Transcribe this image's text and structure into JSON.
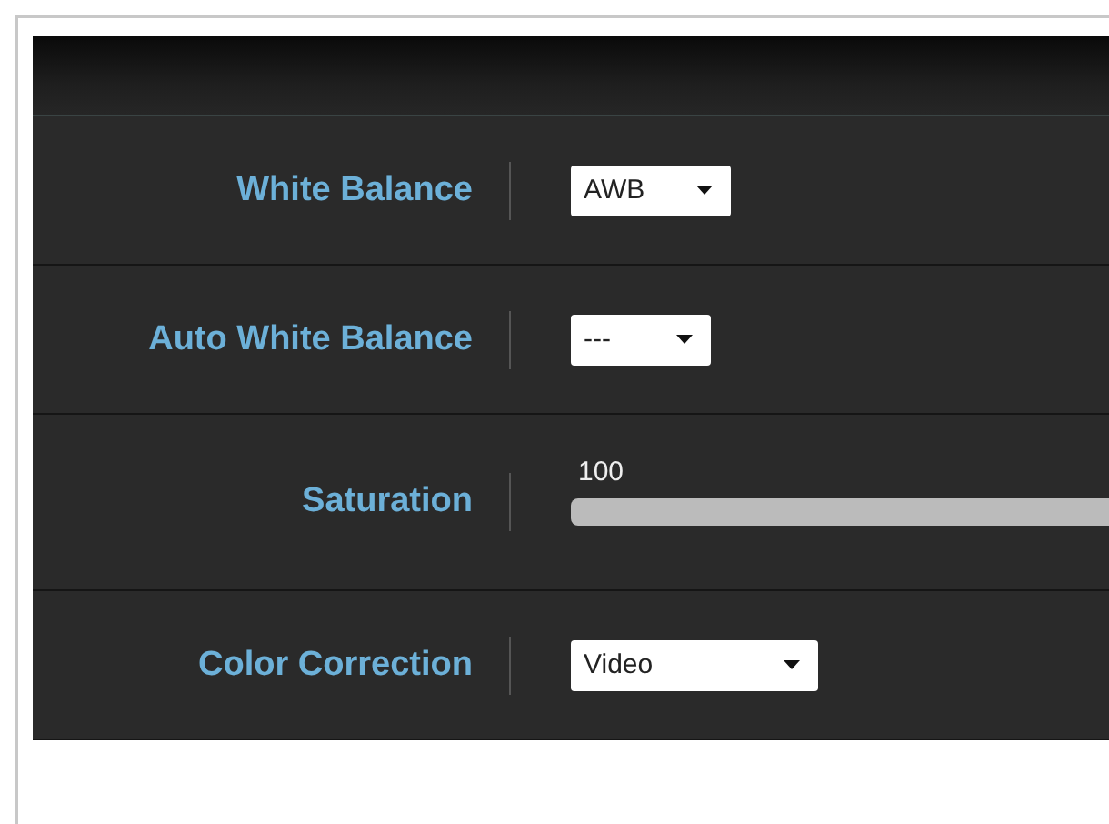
{
  "settings": [
    {
      "label": "White Balance",
      "kind": "select",
      "value": "AWB"
    },
    {
      "label": "Auto White Balance",
      "kind": "select",
      "value": "---"
    },
    {
      "label": "Saturation",
      "kind": "slider",
      "reading": "100"
    },
    {
      "label": "Color Correction",
      "kind": "select",
      "value": "Video"
    }
  ]
}
